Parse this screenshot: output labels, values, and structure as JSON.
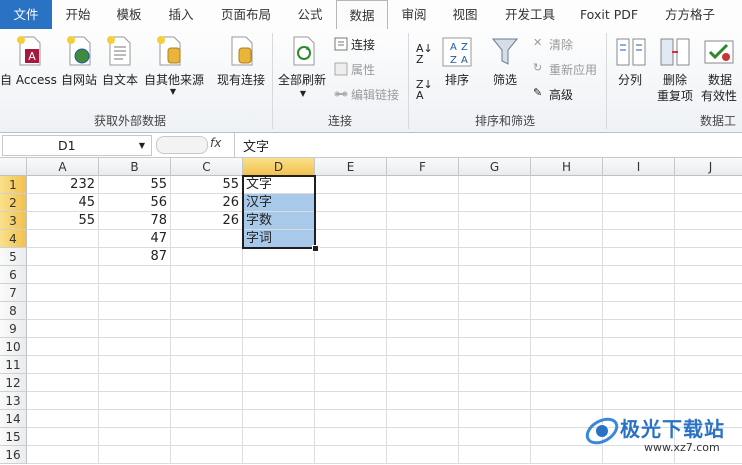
{
  "tabs": [
    {
      "label": "文件"
    },
    {
      "label": "开始"
    },
    {
      "label": "模板"
    },
    {
      "label": "插入"
    },
    {
      "label": "页面布局"
    },
    {
      "label": "公式"
    },
    {
      "label": "数据"
    },
    {
      "label": "审阅"
    },
    {
      "label": "视图"
    },
    {
      "label": "开发工具"
    },
    {
      "label": "Foxit PDF"
    },
    {
      "label": "方方格子"
    }
  ],
  "ribbon": {
    "external": {
      "access": "自 Access",
      "web": "自网站",
      "text": "自文本",
      "other": "自其他来源",
      "existing": "现有连接",
      "group": "获取外部数据"
    },
    "connections": {
      "refresh": "全部刷新",
      "connect": "连接",
      "props": "属性",
      "edit_links": "编辑链接",
      "group": "连接"
    },
    "sort": {
      "sort": "排序",
      "filter": "筛选",
      "clear": "清除",
      "reapply": "重新应用",
      "advanced": "高级",
      "group": "排序和筛选"
    },
    "tools": {
      "split": "分列",
      "remove1": "删除",
      "remove2": "重复项",
      "valid1": "数据",
      "valid2": "有效性",
      "group": "数据工"
    }
  },
  "formula_bar": {
    "name_box": "D1",
    "fx": "fx",
    "content": "文字"
  },
  "sheet": {
    "columns": [
      "A",
      "B",
      "C",
      "D",
      "E",
      "F",
      "G",
      "H",
      "I",
      "J"
    ],
    "rows": [
      "1",
      "2",
      "3",
      "4",
      "5",
      "6",
      "7",
      "8",
      "9",
      "10",
      "11",
      "12",
      "13",
      "14",
      "15",
      "16"
    ],
    "cells": {
      "A1": "232",
      "B1": "55",
      "C1": "55",
      "D1": "文字",
      "A2": "45",
      "B2": "56",
      "C2": "26",
      "D2": "汉字",
      "A3": "55",
      "B3": "78",
      "C3": "26",
      "D3": "字数",
      "B4": "47",
      "D4": "字词",
      "B5": "87"
    }
  },
  "watermark": {
    "text": "极光下载站",
    "url": "www.xz7.com"
  }
}
